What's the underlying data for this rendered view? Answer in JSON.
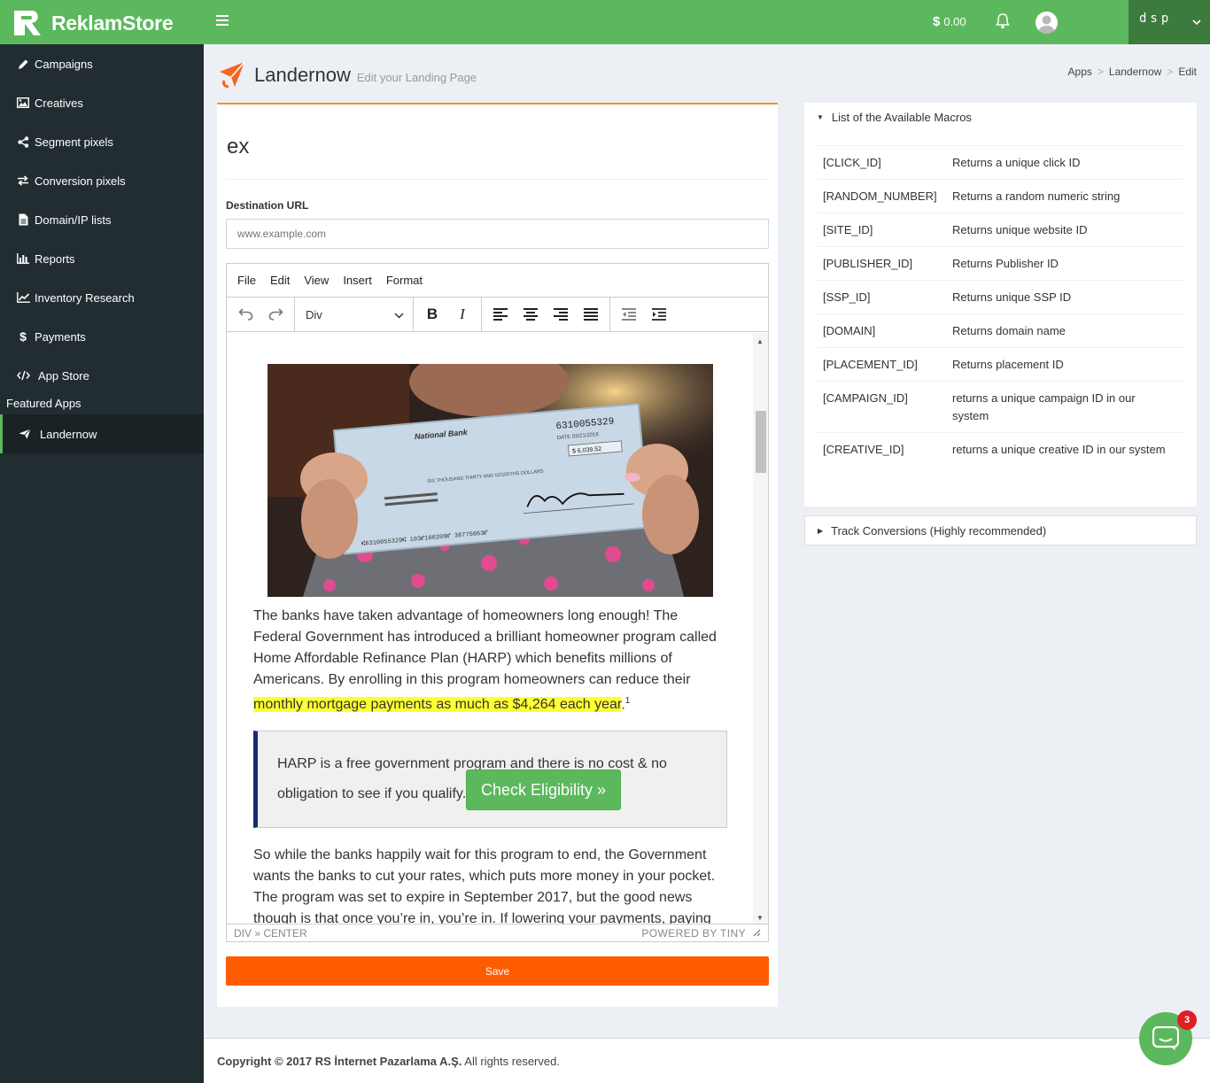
{
  "brand": {
    "name": "ReklamStore"
  },
  "topbar": {
    "balance": "0.00",
    "currency_symbol": "$",
    "username": "dsp"
  },
  "sidebar": {
    "items": [
      {
        "label": "Campaigns",
        "icon": "pencil-icon"
      },
      {
        "label": "Creatives",
        "icon": "image-icon"
      },
      {
        "label": "Segment pixels",
        "icon": "share-icon"
      },
      {
        "label": "Conversion pixels",
        "icon": "exchange-icon"
      },
      {
        "label": "Domain/IP lists",
        "icon": "file-icon"
      },
      {
        "label": "Reports",
        "icon": "bar-chart-icon"
      },
      {
        "label": "Inventory Research",
        "icon": "line-chart-icon"
      },
      {
        "label": "Payments",
        "icon": "dollar-icon"
      },
      {
        "label": "App Store",
        "icon": "code-icon"
      }
    ],
    "featured_header": "Featured Apps",
    "featured": [
      {
        "label": "Landernow",
        "icon": "paper-plane-icon"
      }
    ]
  },
  "header": {
    "title": "Landernow",
    "subtitle": "Edit your Landing Page"
  },
  "breadcrumb": [
    "Apps",
    "Landernow",
    "Edit"
  ],
  "form": {
    "title": "ex",
    "destination_label": "Destination URL",
    "destination_placeholder": "www.example.com",
    "save_label": "Save"
  },
  "editor": {
    "menu": [
      "File",
      "Edit",
      "View",
      "Insert",
      "Format"
    ],
    "format_value": "Div",
    "status_path": "DIV » CENTER",
    "powered_by": "POWERED BY TINY",
    "content": {
      "p1_text": "The banks have taken advantage of homeowners long enough! The Federal Government has introduced a brilliant homeowner program called Home Affordable Refinance Plan (HARP) which benefits millions of Americans. By enrolling in this program homeowners can reduce their ",
      "p1_highlight": "monthly mortgage payments as much as $4,264 each year",
      "p1_tail": ".",
      "p1_sup": "1",
      "callout_text": "HARP is a free government program and there is no cost & no obligation to see if you qualify.",
      "callout_button": "Check Eligibility »",
      "p2_text": "So while the banks happily wait for this program to end, the Government wants the banks to cut your rates, which puts more money in your pocket. The program was set to expire in September 2017, but the good news though is that once you’re in, you’re in. If lowering your payments, paying"
    },
    "image": {
      "bank": "National Bank",
      "check_number": "6310055329",
      "date": "DATE 03/21/2016",
      "amount": "$ 6,039.52",
      "amount_words": "SIX THOUSAND THIRTY AND 52/100THS DOLLARS",
      "micr": "⑆6310055329⑆ 103⑈100209⑈ 38775063⑈"
    }
  },
  "macros": {
    "title": "List of the Available Macros",
    "rows": [
      {
        "macro": "[CLICK_ID]",
        "desc": "Returns a unique click ID"
      },
      {
        "macro": "[RANDOM_NUMBER]",
        "desc": "Returns a random numeric string"
      },
      {
        "macro": "[SITE_ID]",
        "desc": "Returns unique website ID"
      },
      {
        "macro": "[PUBLISHER_ID]",
        "desc": "Returns Publisher ID"
      },
      {
        "macro": "[SSP_ID]",
        "desc": "Returns unique SSP ID"
      },
      {
        "macro": "[DOMAIN]",
        "desc": "Returns domain name"
      },
      {
        "macro": "[PLACEMENT_ID]",
        "desc": "Returns placement ID"
      },
      {
        "macro": "[CAMPAIGN_ID]",
        "desc": "returns a unique campaign ID in our system"
      },
      {
        "macro": "[CREATIVE_ID]",
        "desc": "returns a unique creative ID in our system"
      }
    ]
  },
  "track": {
    "title": "Track Conversions (Highly recommended)"
  },
  "footer": {
    "copyright": "Copyright © 2017 RS İnternet Pazarlama A.Ş.",
    "rights": " All rights reserved."
  },
  "chat": {
    "badge": "3"
  },
  "colors": {
    "brand_green": "#5cb85c",
    "sidebar_bg": "#222d32",
    "save_orange": "#ff5c00",
    "accent": "#f0932b"
  }
}
